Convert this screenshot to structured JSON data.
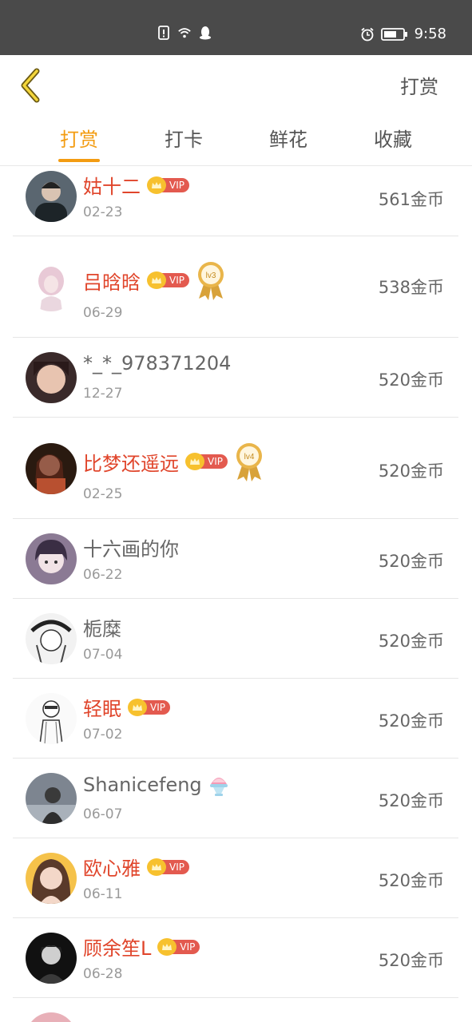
{
  "status_bar": {
    "time": "9:58",
    "icons": [
      "sim-alert-icon",
      "wifi-icon",
      "qq-icon",
      "alarm-icon",
      "battery-icon"
    ]
  },
  "nav": {
    "action_label": "打赏"
  },
  "tabs": [
    {
      "label": "打赏",
      "active": true
    },
    {
      "label": "打卡",
      "active": false
    },
    {
      "label": "鲜花",
      "active": false
    },
    {
      "label": "收藏",
      "active": false
    }
  ],
  "vip_label": "VIP",
  "rows": [
    {
      "name": "姑十二",
      "date": "02-23",
      "coins": "561金币",
      "vip": true
    },
    {
      "name": "吕晗晗",
      "date": "06-29",
      "coins": "538金币",
      "vip": true,
      "medal": "lv3"
    },
    {
      "name": "*_*_978371204",
      "date": "12-27",
      "coins": "520金币",
      "vip": false
    },
    {
      "name": "比梦还遥远",
      "date": "02-25",
      "coins": "520金币",
      "vip": true,
      "medal": "lv4"
    },
    {
      "name": "十六画的你",
      "date": "06-22",
      "coins": "520金币",
      "vip": false
    },
    {
      "name": "栀糜",
      "date": "07-04",
      "coins": "520金币",
      "vip": false
    },
    {
      "name": "轻眠",
      "date": "07-02",
      "coins": "520金币",
      "vip": true
    },
    {
      "name": "Shanicefeng",
      "date": "06-07",
      "coins": "520金币",
      "vip": false,
      "emoji": "shaved-ice-icon"
    },
    {
      "name": "欧心雅",
      "date": "06-11",
      "coins": "520金币",
      "vip": true
    },
    {
      "name": "顾余笙L",
      "date": "06-28",
      "coins": "520金币",
      "vip": true
    }
  ],
  "colors": {
    "accent": "#f39c12",
    "vip_name": "#e0452b",
    "vip_badge": "#e35a4f",
    "crown": "#f7c12e",
    "status_bar": "#4a4a4a"
  }
}
